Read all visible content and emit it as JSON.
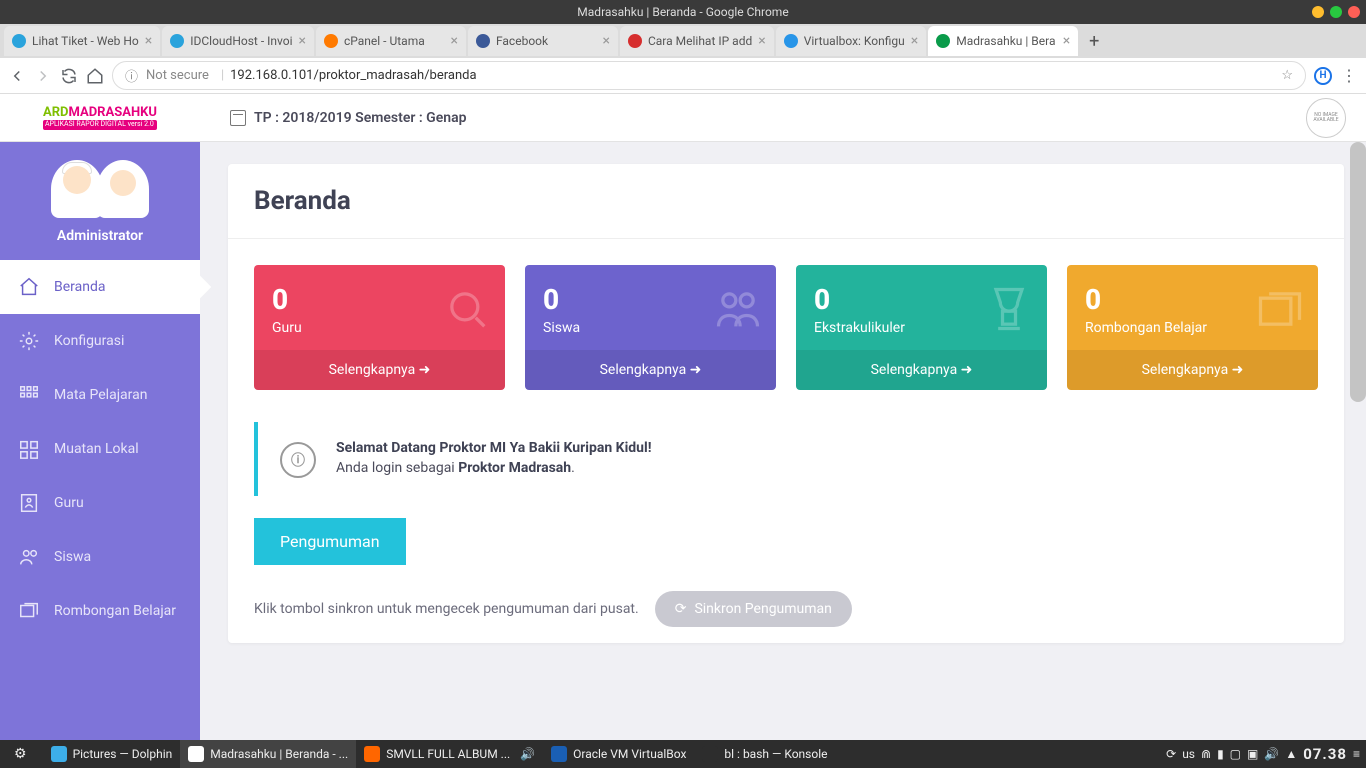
{
  "window": {
    "title": "Madrasahku | Beranda - Google Chrome"
  },
  "tabs": [
    {
      "title": "Lihat Tiket - Web Ho",
      "icon": "#2aa3dc"
    },
    {
      "title": "IDCloudHost - Invoi",
      "icon": "#2aa3dc"
    },
    {
      "title": "cPanel - Utama",
      "icon": "#ff7a00"
    },
    {
      "title": "Facebook",
      "icon": "#3b5998"
    },
    {
      "title": "Cara Melihat IP add",
      "icon": "#d62e2e"
    },
    {
      "title": "Virtualbox: Konfigu",
      "icon": "#2895e8"
    },
    {
      "title": "Madrasahku | Bera",
      "icon": "#0a9b4a",
      "active": true
    }
  ],
  "url": {
    "secure": "Not secure",
    "address": "192.168.0.101/proktor_madrasah/beranda",
    "info": "ⓘ"
  },
  "brand": {
    "ard": "ARD",
    "mad": "MADRASAHKU",
    "sub": "APLIKASI RAPOR DIGITAL versi 2.0"
  },
  "header": {
    "tp": "TP : 2018/2019  Semester : Genap",
    "noimage": "NO IMAGE AVAILABLE"
  },
  "sidebar": {
    "role": "Administrator",
    "items": [
      {
        "label": "Beranda",
        "active": true
      },
      {
        "label": "Konfigurasi"
      },
      {
        "label": "Mata Pelajaran"
      },
      {
        "label": "Muatan Lokal"
      },
      {
        "label": "Guru"
      },
      {
        "label": "Siswa"
      },
      {
        "label": "Rombongan Belajar"
      }
    ]
  },
  "page": {
    "title": "Beranda",
    "cards": [
      {
        "num": "0",
        "label": "Guru",
        "more": "Selengkapnya"
      },
      {
        "num": "0",
        "label": "Siswa",
        "more": "Selengkapnya"
      },
      {
        "num": "0",
        "label": "Ekstrakulikuler",
        "more": "Selengkapnya"
      },
      {
        "num": "0",
        "label": "Rombongan Belajar",
        "more": "Selengkapnya"
      }
    ],
    "welcome": {
      "title": "Selamat Datang Proktor MI Ya Bakii Kuripan Kidul!",
      "line_pre": "Anda login sebagai ",
      "line_role": "Proktor Madrasah",
      "line_post": "."
    },
    "announce": {
      "tab": "Pengumuman",
      "hint": "Klik tombol sinkron untuk mengecek pengumuman dari pusat.",
      "button": "Sinkron Pengumuman"
    }
  },
  "taskbar": {
    "items": [
      {
        "label": "Pictures — Dolphin",
        "icon": "#3daee9"
      },
      {
        "label": "Madrasahku | Beranda - ...",
        "icon": "#fff",
        "active": true
      },
      {
        "label": "SMVLL FULL ALBUM ...",
        "icon": "#ff6600"
      },
      {
        "label": "Oracle VM VirtualBox",
        "icon": "#1a5fb4"
      },
      {
        "label": "bl : bash — Konsole",
        "icon": "#2d2d2d"
      }
    ],
    "kb": "us",
    "clock": "07.38"
  }
}
